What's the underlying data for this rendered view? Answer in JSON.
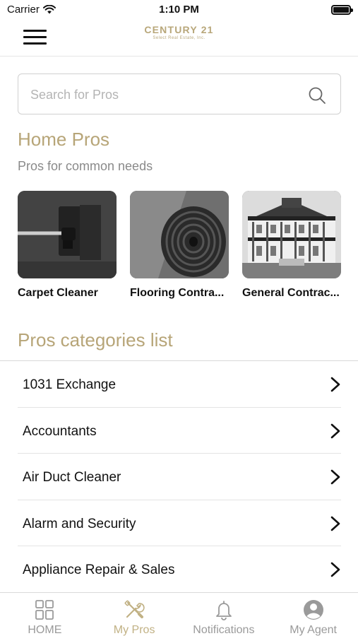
{
  "status_bar": {
    "carrier": "Carrier",
    "time": "1:10 PM"
  },
  "header": {
    "logo_title": "CENTURY 21",
    "logo_subtitle": "Select Real Estate, Inc."
  },
  "search": {
    "placeholder": "Search for Pros",
    "value": ""
  },
  "home_pros": {
    "title": "Home Pros",
    "subtitle": "Pros for common needs",
    "cards": [
      {
        "label": "Carpet Cleaner",
        "image": "carpet-cleaner-image"
      },
      {
        "label": "Flooring Contra...",
        "image": "rolled-carpet-image"
      },
      {
        "label": "General Contrac...",
        "image": "house-image"
      }
    ]
  },
  "categories": {
    "title": "Pros categories list",
    "items": [
      {
        "label": "1031 Exchange"
      },
      {
        "label": "Accountants"
      },
      {
        "label": "Air Duct Cleaner"
      },
      {
        "label": "Alarm and Security"
      },
      {
        "label": "Appliance Repair & Sales"
      }
    ]
  },
  "tab_bar": {
    "tabs": [
      {
        "label": "HOME",
        "icon": "grid-icon",
        "active": false
      },
      {
        "label": "My Pros",
        "icon": "tools-icon",
        "active": true
      },
      {
        "label": "Notifications",
        "icon": "bell-icon",
        "active": false
      },
      {
        "label": "My Agent",
        "icon": "person-icon",
        "active": false
      }
    ]
  },
  "colors": {
    "accent": "#b7a578",
    "text": "#111111",
    "muted": "#8a8a8a",
    "inactive_tab": "#9a9a9a"
  }
}
